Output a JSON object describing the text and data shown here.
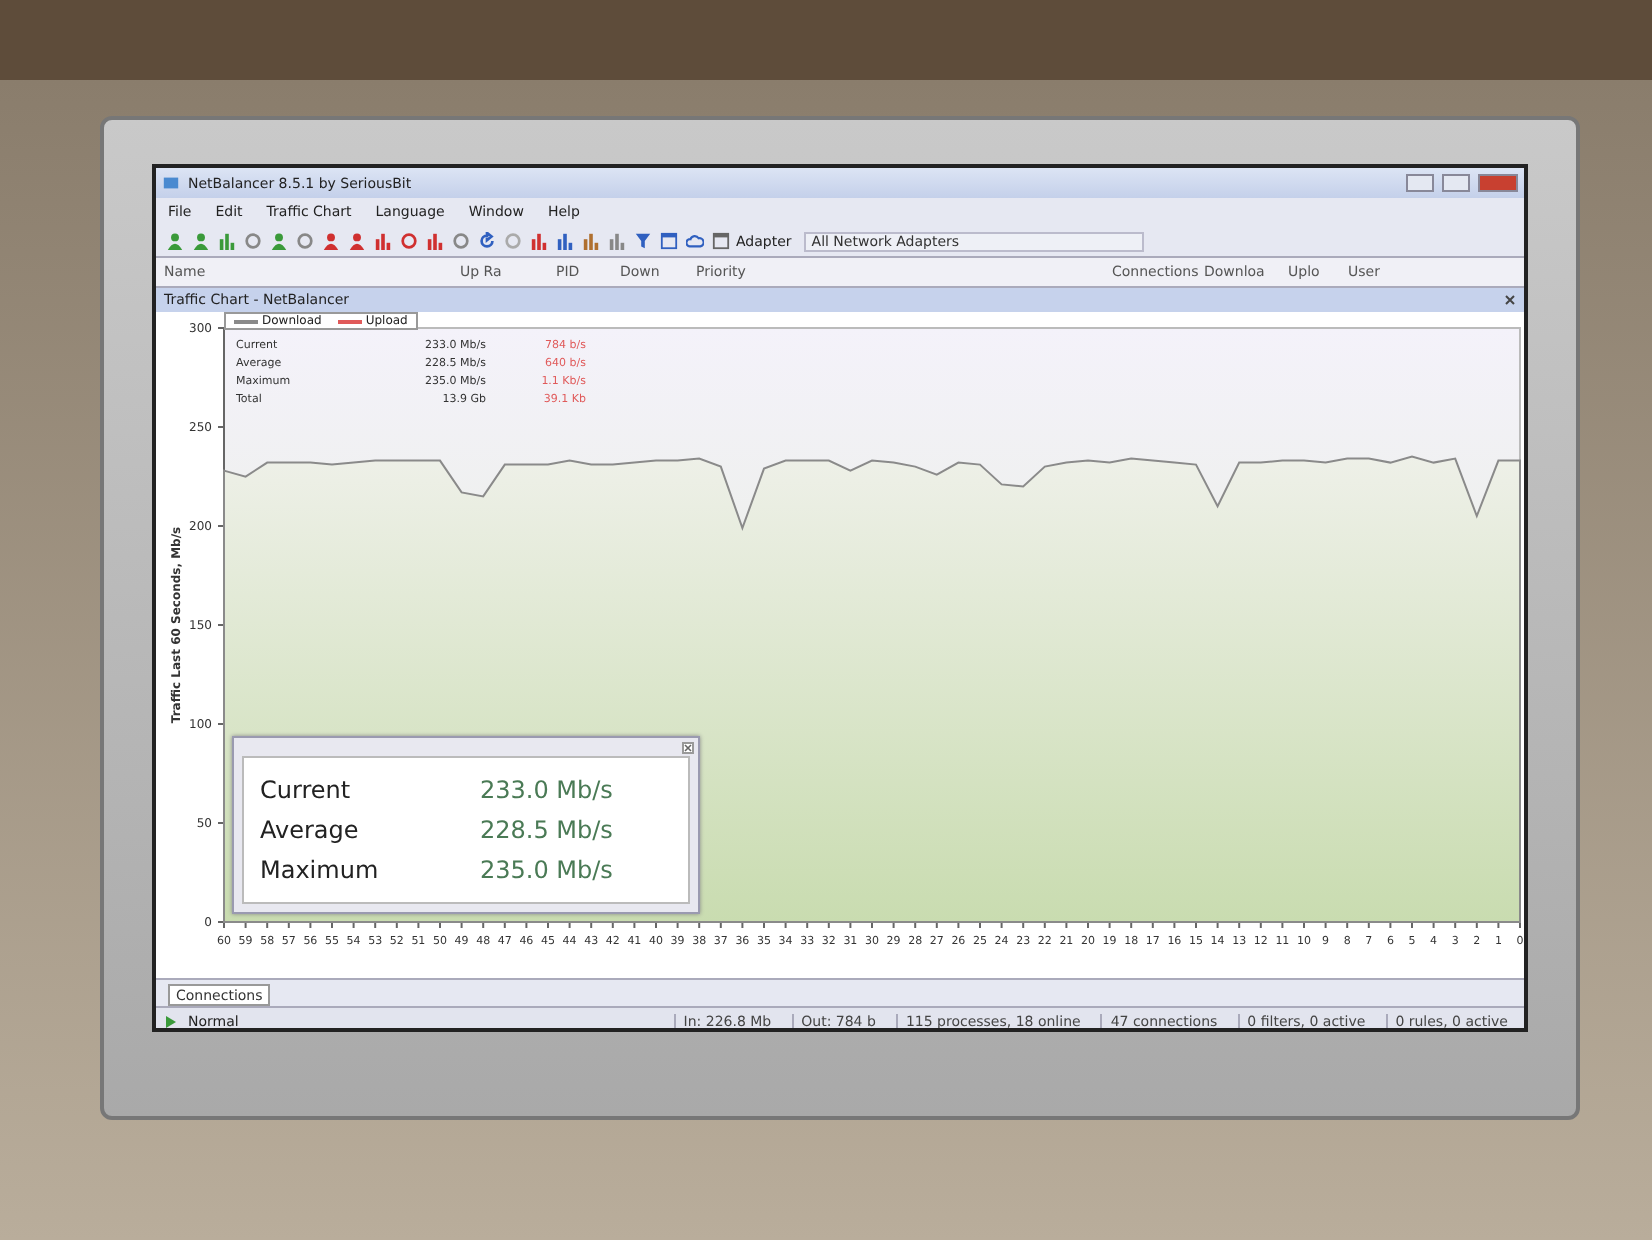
{
  "window": {
    "title": "NetBalancer 8.5.1 by SeriousBit"
  },
  "menu": [
    "File",
    "Edit",
    "Traffic Chart",
    "Language",
    "Window",
    "Help"
  ],
  "toolbar": {
    "adapter_label": "Adapter",
    "adapter_value": "All Network Adapters"
  },
  "columns": [
    "Name",
    "Up Ra",
    "PID",
    "Down",
    "Priority",
    "Connections",
    "Downloa",
    "Uplo",
    "User"
  ],
  "panel": {
    "title": "Traffic Chart - NetBalancer",
    "legend_more": [
      {
        "name": "Upload",
        "color": "#e05a5a"
      }
    ],
    "stats": [
      {
        "label": "Current",
        "download": "233.0 Mb/s",
        "upload": "784 b/s"
      },
      {
        "label": "Average",
        "download": "228.5 Mb/s",
        "upload": "640 b/s"
      },
      {
        "label": "Maximum",
        "download": "235.0 Mb/s",
        "upload": "1.1 Kb/s"
      },
      {
        "label": "Total",
        "download": "13.9 Gb",
        "upload": "39.1 Kb"
      }
    ],
    "chart_data": {
      "type": "area",
      "ylabel": "Traffic Last 60 Seconds, Mb/s",
      "categories": [
        "60",
        "59",
        "58",
        "57",
        "56",
        "55",
        "54",
        "53",
        "52",
        "51",
        "50",
        "49",
        "48",
        "47",
        "46",
        "45",
        "44",
        "43",
        "42",
        "41",
        "40",
        "39",
        "38",
        "37",
        "36",
        "35",
        "34",
        "33",
        "32",
        "31",
        "30",
        "29",
        "28",
        "27",
        "26",
        "25",
        "24",
        "23",
        "22",
        "21",
        "20",
        "19",
        "18",
        "17",
        "16",
        "15",
        "14",
        "13",
        "12",
        "11",
        "10",
        "9",
        "8",
        "7",
        "6",
        "5",
        "4",
        "3",
        "2",
        "1",
        "0"
      ],
      "series": [
        {
          "name": "Download",
          "color": "#8a8a8a",
          "values": [
            228,
            225,
            232,
            232,
            232,
            231,
            232,
            233,
            233,
            233,
            233,
            217,
            215,
            231,
            231,
            231,
            233,
            231,
            231,
            232,
            233,
            233,
            234,
            230,
            199,
            229,
            233,
            233,
            233,
            228,
            233,
            232,
            230,
            226,
            232,
            231,
            221,
            220,
            230,
            232,
            233,
            232,
            234,
            233,
            232,
            231,
            210,
            232,
            232,
            233,
            233,
            232,
            234,
            234,
            232,
            235,
            232,
            234,
            205,
            233,
            233
          ]
        }
      ],
      "ylim": [
        0,
        300
      ],
      "yticks": [
        0,
        50,
        100,
        150,
        200,
        250,
        300
      ]
    }
  },
  "popup": {
    "rows": [
      {
        "label": "Current",
        "value": "233.0 Mb/s"
      },
      {
        "label": "Average",
        "value": "228.5 Mb/s"
      },
      {
        "label": "Maximum",
        "value": "235.0 Mb/s"
      }
    ]
  },
  "bottom_tabs": [
    {
      "label": "Connections",
      "selected": true
    }
  ],
  "status": {
    "priority": "Normal",
    "items": [
      "In: 226.8 Mb",
      "Out: 784 b",
      "115 processes, 18 online",
      "47 connections",
      "0 filters, 0 active",
      "0 rules, 0 active"
    ]
  }
}
